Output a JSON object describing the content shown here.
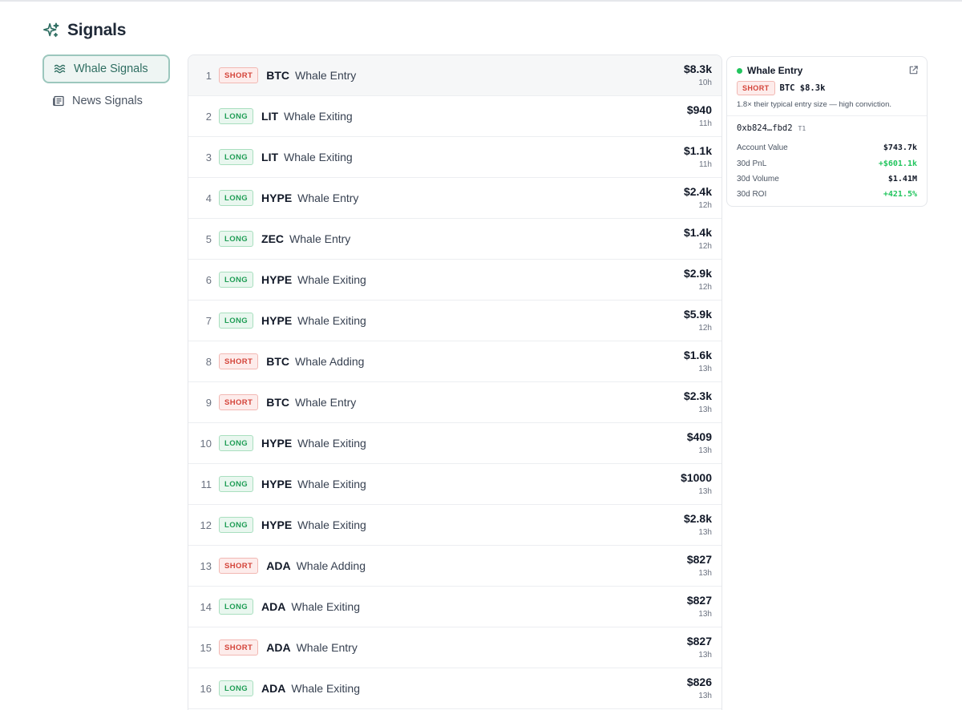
{
  "page": {
    "title": "Signals"
  },
  "sidebar": {
    "items": [
      {
        "label": "Whale Signals",
        "icon": "waves-icon",
        "active": true
      },
      {
        "label": "News Signals",
        "icon": "newspaper-icon",
        "active": false
      }
    ]
  },
  "signals": [
    {
      "rank": "1",
      "side": "SHORT",
      "symbol": "BTC",
      "event": "Whale Entry",
      "amount": "$8.3k",
      "age": "10h"
    },
    {
      "rank": "2",
      "side": "LONG",
      "symbol": "LIT",
      "event": "Whale Exiting",
      "amount": "$940",
      "age": "11h"
    },
    {
      "rank": "3",
      "side": "LONG",
      "symbol": "LIT",
      "event": "Whale Exiting",
      "amount": "$1.1k",
      "age": "11h"
    },
    {
      "rank": "4",
      "side": "LONG",
      "symbol": "HYPE",
      "event": "Whale Entry",
      "amount": "$2.4k",
      "age": "12h"
    },
    {
      "rank": "5",
      "side": "LONG",
      "symbol": "ZEC",
      "event": "Whale Entry",
      "amount": "$1.4k",
      "age": "12h"
    },
    {
      "rank": "6",
      "side": "LONG",
      "symbol": "HYPE",
      "event": "Whale Exiting",
      "amount": "$2.9k",
      "age": "12h"
    },
    {
      "rank": "7",
      "side": "LONG",
      "symbol": "HYPE",
      "event": "Whale Exiting",
      "amount": "$5.9k",
      "age": "12h"
    },
    {
      "rank": "8",
      "side": "SHORT",
      "symbol": "BTC",
      "event": "Whale Adding",
      "amount": "$1.6k",
      "age": "13h"
    },
    {
      "rank": "9",
      "side": "SHORT",
      "symbol": "BTC",
      "event": "Whale Entry",
      "amount": "$2.3k",
      "age": "13h"
    },
    {
      "rank": "10",
      "side": "LONG",
      "symbol": "HYPE",
      "event": "Whale Exiting",
      "amount": "$409",
      "age": "13h"
    },
    {
      "rank": "11",
      "side": "LONG",
      "symbol": "HYPE",
      "event": "Whale Exiting",
      "amount": "$1000",
      "age": "13h"
    },
    {
      "rank": "12",
      "side": "LONG",
      "symbol": "HYPE",
      "event": "Whale Exiting",
      "amount": "$2.8k",
      "age": "13h"
    },
    {
      "rank": "13",
      "side": "SHORT",
      "symbol": "ADA",
      "event": "Whale Adding",
      "amount": "$827",
      "age": "13h"
    },
    {
      "rank": "14",
      "side": "LONG",
      "symbol": "ADA",
      "event": "Whale Exiting",
      "amount": "$827",
      "age": "13h"
    },
    {
      "rank": "15",
      "side": "SHORT",
      "symbol": "ADA",
      "event": "Whale Entry",
      "amount": "$827",
      "age": "13h"
    },
    {
      "rank": "16",
      "side": "LONG",
      "symbol": "ADA",
      "event": "Whale Exiting",
      "amount": "$826",
      "age": "13h"
    }
  ],
  "detail": {
    "title": "Whale Entry",
    "status_color": "#22c55e",
    "side": "SHORT",
    "position": "BTC $8.3k",
    "note": "1.8× their typical entry size — high conviction.",
    "address": "0xb824…fbd2",
    "tier": "T1",
    "stats": [
      {
        "label": "Account Value",
        "value": "$743.7k",
        "positive": false
      },
      {
        "label": "30d PnL",
        "value": "+$601.1k",
        "positive": true
      },
      {
        "label": "30d Volume",
        "value": "$1.41M",
        "positive": false
      },
      {
        "label": "30d ROI",
        "value": "+421.5%",
        "positive": true
      }
    ]
  },
  "colors": {
    "accent": "#2f6e62",
    "short": "#d4443a",
    "long": "#1f9d55",
    "positive": "#22c55e"
  }
}
